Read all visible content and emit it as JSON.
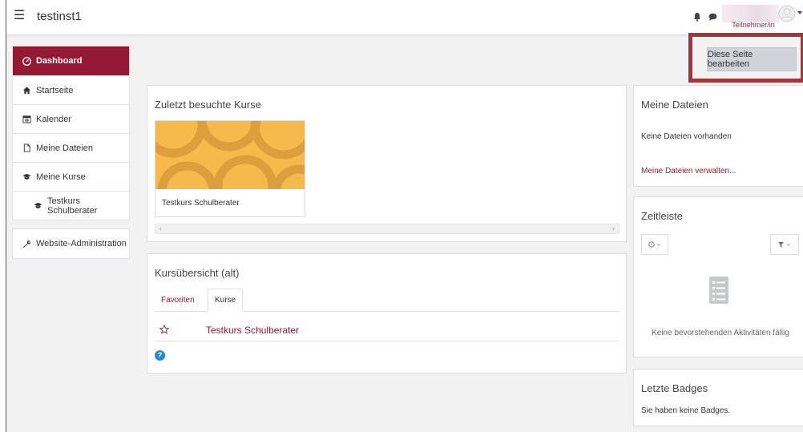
{
  "header": {
    "site_name": "testinst1",
    "user_role": "Teilnehmer/in"
  },
  "sidebar": {
    "items": [
      {
        "label": "Dashboard",
        "icon": "dashboard-icon",
        "active": true
      },
      {
        "label": "Startseite",
        "icon": "home-icon"
      },
      {
        "label": "Kalender",
        "icon": "calendar-icon"
      },
      {
        "label": "Meine Dateien",
        "icon": "file-icon"
      },
      {
        "label": "Meine Kurse",
        "icon": "graduation-cap-icon"
      },
      {
        "label": "Testkurs Schulberater",
        "icon": "graduation-cap-icon"
      }
    ],
    "admin": {
      "label": "Website-Administration",
      "icon": "wrench-icon"
    }
  },
  "edit_button": {
    "label": "Diese Seite bearbeiten"
  },
  "recent_courses": {
    "title": "Zuletzt besuchte Kurse",
    "courses": [
      {
        "name": "Testkurs Schulberater"
      }
    ]
  },
  "overview": {
    "title": "Kursübersicht (alt)",
    "tabs": [
      {
        "label": "Favoriten"
      },
      {
        "label": "Kurse"
      }
    ],
    "courses": [
      {
        "name": "Testkurs Schulberater"
      }
    ]
  },
  "files": {
    "title": "Meine Dateien",
    "empty_text": "Keine Dateien vorhanden",
    "manage_link": "Meine Dateien verwalten..."
  },
  "timeline": {
    "title": "Zeitleiste",
    "empty_text": "Keine bevorstehenden Aktivitäten fällig"
  },
  "badges": {
    "title": "Letzte Badges",
    "empty_text": "Sie haben keine Badges."
  },
  "colors": {
    "brand": "#951934",
    "highlight_border": "#a3363b",
    "help": "#1f8dd6"
  }
}
